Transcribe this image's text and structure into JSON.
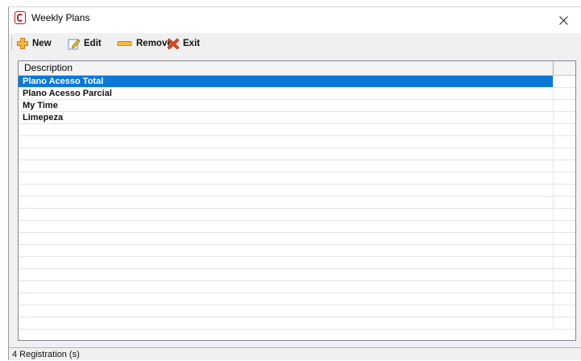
{
  "window": {
    "title": "Weekly Plans"
  },
  "toolbar": {
    "buttons": [
      {
        "label": "New",
        "icon": "plus-icon"
      },
      {
        "label": "Edit",
        "icon": "edit-icon"
      },
      {
        "label": "Remove",
        "icon": "minus-icon"
      },
      {
        "label": "Exit",
        "icon": "close-icon"
      }
    ]
  },
  "grid": {
    "columns": [
      "Description"
    ],
    "rows": [
      {
        "description": "Plano Acesso Total",
        "selected": true
      },
      {
        "description": "Plano Acesso Parcial",
        "selected": false
      },
      {
        "description": "My Time",
        "selected": false
      },
      {
        "description": "Limepeza",
        "selected": false
      }
    ],
    "total_rows_visible": 21
  },
  "status": {
    "text": "4 Registration (s)"
  },
  "colors": {
    "selection": "#0a78d7",
    "plus": "#f5a623",
    "remove": "#f2b233",
    "exit": "#d9381e"
  }
}
